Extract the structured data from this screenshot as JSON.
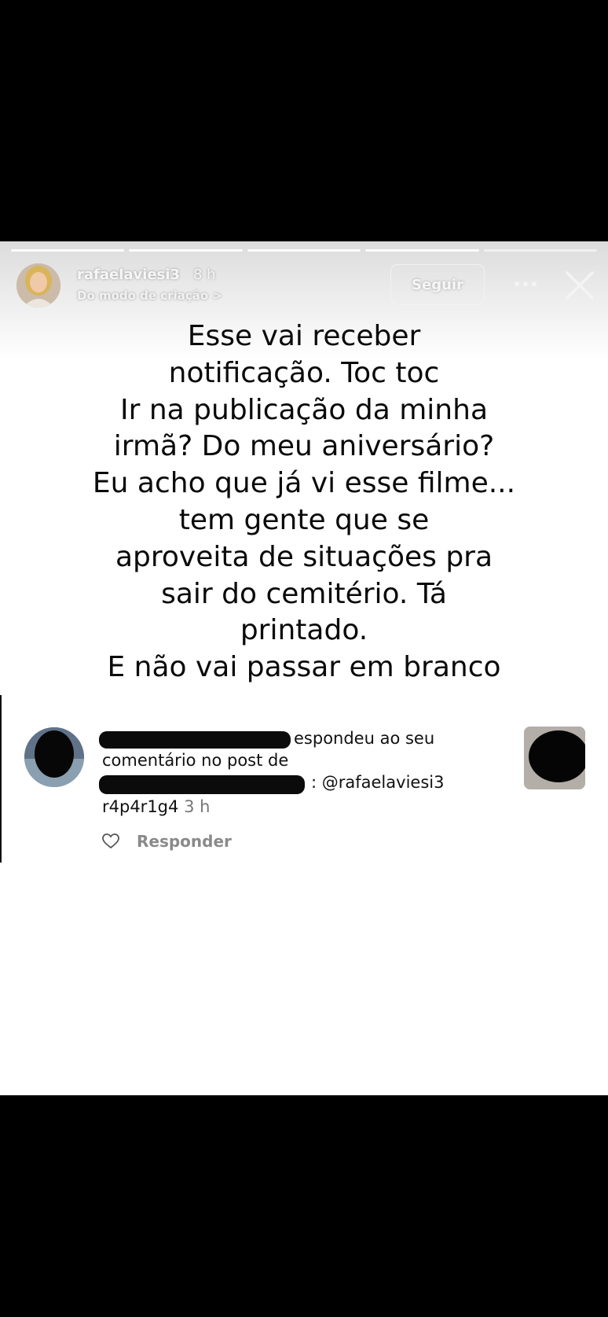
{
  "story": {
    "username": "rafaelaviesi3",
    "time": "8 h",
    "subtitle": "Do modo de criação >",
    "follow_label": "Seguir",
    "more_icon": "more-horizontal-icon",
    "close_icon": "close-icon",
    "caption_lines": [
      "Esse vai receber",
      "notificação. Toc toc",
      "Ir na publicação da minha",
      "irmã? Do meu aniversário?",
      "Eu acho que já vi esse filme...",
      "tem gente que se",
      "aproveita de situações pra",
      "sair do cemitério. Tá",
      "printado.",
      "E não vai passar em branco"
    ]
  },
  "notification": {
    "line1": "espondeu ao seu",
    "line2": "comentário no post de",
    "line3": ": @rafaelaviesi3",
    "handle": "r4p4r1g4",
    "time": "3 h",
    "reply_label": "Responder",
    "heart_icon": "heart-outline-icon"
  },
  "colors": {
    "background": "#000000",
    "story_bg": "#ffffff",
    "text": "#0a0a0a",
    "muted": "#8a8a8a"
  }
}
